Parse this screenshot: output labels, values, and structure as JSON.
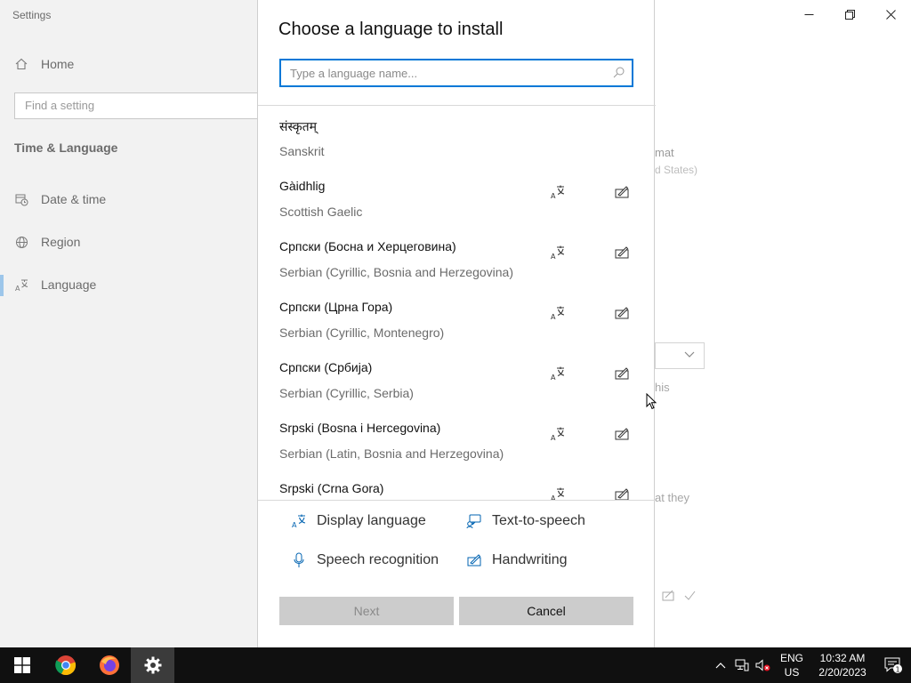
{
  "app": {
    "title": "Settings",
    "window_controls": {
      "minimize": "—",
      "maximize": "❐",
      "close": "✕"
    }
  },
  "sidebar": {
    "home_label": "Home",
    "search_placeholder": "Find a setting",
    "section_title": "Time & Language",
    "items": [
      {
        "label": "Date & time",
        "icon": "calendar-clock-icon"
      },
      {
        "label": "Region",
        "icon": "globe-icon"
      },
      {
        "label": "Language",
        "icon": "language-icon",
        "active": true
      }
    ]
  },
  "background_fragments": {
    "format_text": "mat",
    "region_value": "d States)",
    "this_text": "his",
    "they_text": "at they"
  },
  "dialog": {
    "title": "Choose a language to install",
    "search_placeholder": "Type a language name...",
    "languages": [
      {
        "native": "संस्कृतम्",
        "english": "Sanskrit",
        "display_language": false,
        "handwriting": false
      },
      {
        "native": "Gàidhlig",
        "english": "Scottish Gaelic",
        "display_language": true,
        "handwriting": true
      },
      {
        "native": "Српски (Босна и Херцеговина)",
        "english": "Serbian (Cyrillic, Bosnia and Herzegovina)",
        "display_language": true,
        "handwriting": true
      },
      {
        "native": "Српски (Црна Гора)",
        "english": "Serbian (Cyrillic, Montenegro)",
        "display_language": true,
        "handwriting": true
      },
      {
        "native": "Српски (Србија)",
        "english": "Serbian (Cyrillic, Serbia)",
        "display_language": true,
        "handwriting": true
      },
      {
        "native": "Srpski (Bosna i Hercegovina)",
        "english": "Serbian (Latin, Bosnia and Herzegovina)",
        "display_language": true,
        "handwriting": true
      },
      {
        "native": "Srpski (Crna Gora)",
        "english": "",
        "display_language": true,
        "handwriting": true
      }
    ],
    "legend": {
      "display_language": "Display language",
      "text_to_speech": "Text-to-speech",
      "speech_recognition": "Speech recognition",
      "handwriting": "Handwriting"
    },
    "buttons": {
      "next": "Next",
      "cancel": "Cancel"
    }
  },
  "taskbar": {
    "apps": [
      "windows-start",
      "chrome",
      "firefox",
      "settings"
    ],
    "input_lang_line1": "ENG",
    "input_lang_line2": "US",
    "time": "10:32 AM",
    "date": "2/20/2023",
    "notification_count": "1"
  },
  "colors": {
    "accent": "#0078d7",
    "icon_blue": "#0063b1",
    "taskbar": "#101010"
  }
}
